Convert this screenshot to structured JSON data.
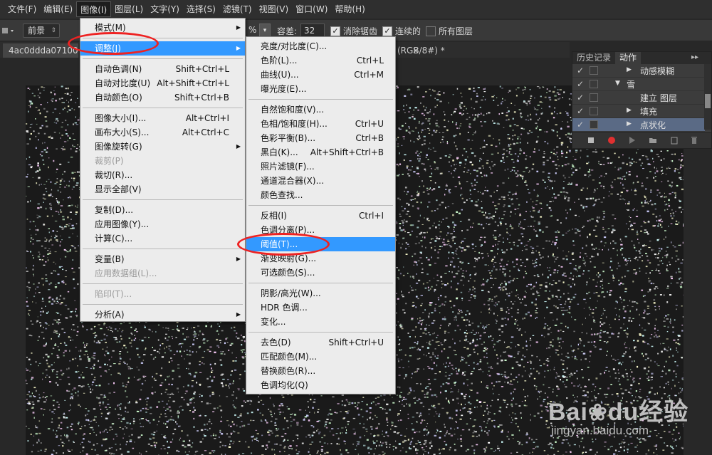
{
  "menubar": {
    "items": [
      "文件(F)",
      "编辑(E)",
      "图像(I)",
      "图层(L)",
      "文字(Y)",
      "选择(S)",
      "滤镜(T)",
      "视图(V)",
      "窗口(W)",
      "帮助(H)"
    ],
    "active": "图像(I)"
  },
  "optionsbar": {
    "mode_select": "前景",
    "percent_char": "%",
    "tolerance_label": "容差:",
    "tolerance_value": "32",
    "anti_alias": {
      "label": "消除锯齿",
      "checked": true
    },
    "contiguous": {
      "label": "连续的",
      "checked": true
    },
    "all_layers": {
      "label": "所有图层",
      "checked": false
    }
  },
  "tabs": {
    "doc_title": "4ac0ddda0710069",
    "doc_title_suffix": "(RGB/8#) *",
    "close": "×"
  },
  "panel": {
    "tab_history": "历史记录",
    "tab_actions": "动作",
    "menu_icon": "▸▸",
    "rows": [
      {
        "label": "动感模糊",
        "checked": true,
        "indent": 2,
        "expand": "right"
      },
      {
        "label": "雪",
        "checked": true,
        "indent": 1,
        "expand": "down"
      },
      {
        "label": "建立 图层",
        "checked": true,
        "indent": 2,
        "expand": ""
      },
      {
        "label": "填充",
        "checked": true,
        "indent": 2,
        "expand": "right"
      },
      {
        "label": "点状化",
        "checked": true,
        "indent": 2,
        "expand": "right",
        "selected": true
      }
    ],
    "footer_icons": [
      "stop-icon",
      "record-icon",
      "play-icon",
      "folder-icon",
      "new-icon",
      "delete-icon"
    ]
  },
  "menu_image": {
    "items": [
      {
        "label": "模式(M)",
        "shortcut": "",
        "submenu": true
      },
      {
        "sep": true
      },
      {
        "label": "调整(J)",
        "shortcut": "",
        "submenu": true,
        "highlighted": true
      },
      {
        "sep": true
      },
      {
        "label": "自动色调(N)",
        "shortcut": "Shift+Ctrl+L"
      },
      {
        "label": "自动对比度(U)",
        "shortcut": "Alt+Shift+Ctrl+L"
      },
      {
        "label": "自动颜色(O)",
        "shortcut": "Shift+Ctrl+B"
      },
      {
        "sep": true
      },
      {
        "label": "图像大小(I)...",
        "shortcut": "Alt+Ctrl+I"
      },
      {
        "label": "画布大小(S)...",
        "shortcut": "Alt+Ctrl+C"
      },
      {
        "label": "图像旋转(G)",
        "shortcut": "",
        "submenu": true
      },
      {
        "label": "裁剪(P)",
        "shortcut": "",
        "disabled": true
      },
      {
        "label": "裁切(R)...",
        "shortcut": ""
      },
      {
        "label": "显示全部(V)",
        "shortcut": ""
      },
      {
        "sep": true
      },
      {
        "label": "复制(D)...",
        "shortcut": ""
      },
      {
        "label": "应用图像(Y)...",
        "shortcut": ""
      },
      {
        "label": "计算(C)...",
        "shortcut": ""
      },
      {
        "sep": true
      },
      {
        "label": "变量(B)",
        "shortcut": "",
        "submenu": true
      },
      {
        "label": "应用数据组(L)...",
        "shortcut": "",
        "disabled": true
      },
      {
        "sep": true
      },
      {
        "label": "陷印(T)...",
        "shortcut": "",
        "disabled": true
      },
      {
        "sep": true
      },
      {
        "label": "分析(A)",
        "shortcut": "",
        "submenu": true
      }
    ]
  },
  "menu_adjust": {
    "items": [
      {
        "label": "亮度/对比度(C)...",
        "shortcut": ""
      },
      {
        "label": "色阶(L)...",
        "shortcut": "Ctrl+L"
      },
      {
        "label": "曲线(U)...",
        "shortcut": "Ctrl+M"
      },
      {
        "label": "曝光度(E)...",
        "shortcut": ""
      },
      {
        "sep": true
      },
      {
        "label": "自然饱和度(V)...",
        "shortcut": ""
      },
      {
        "label": "色相/饱和度(H)...",
        "shortcut": "Ctrl+U"
      },
      {
        "label": "色彩平衡(B)...",
        "shortcut": "Ctrl+B"
      },
      {
        "label": "黑白(K)...",
        "shortcut": "Alt+Shift+Ctrl+B"
      },
      {
        "label": "照片滤镜(F)...",
        "shortcut": ""
      },
      {
        "label": "通道混合器(X)...",
        "shortcut": ""
      },
      {
        "label": "颜色查找...",
        "shortcut": ""
      },
      {
        "sep": true
      },
      {
        "label": "反相(I)",
        "shortcut": "Ctrl+I"
      },
      {
        "label": "色调分离(P)...",
        "shortcut": ""
      },
      {
        "label": "阈值(T)...",
        "shortcut": "",
        "highlighted": true
      },
      {
        "label": "渐变映射(G)...",
        "shortcut": ""
      },
      {
        "label": "可选颜色(S)...",
        "shortcut": ""
      },
      {
        "sep": true
      },
      {
        "label": "阴影/高光(W)...",
        "shortcut": ""
      },
      {
        "label": "HDR 色调...",
        "shortcut": ""
      },
      {
        "label": "变化...",
        "shortcut": ""
      },
      {
        "sep": true
      },
      {
        "label": "去色(D)",
        "shortcut": "Shift+Ctrl+U"
      },
      {
        "label": "匹配颜色(M)...",
        "shortcut": ""
      },
      {
        "label": "替换颜色(R)...",
        "shortcut": ""
      },
      {
        "label": "色调均化(Q)",
        "shortcut": ""
      }
    ]
  },
  "watermark": {
    "brand_a": "Bai",
    "brand_b": "du",
    "brand_c": "经验",
    "url": "jingyan.baidu.com"
  },
  "colors": {
    "highlight": "#3399ff",
    "annotation_ring": "#e22222",
    "record": "#e03030"
  }
}
